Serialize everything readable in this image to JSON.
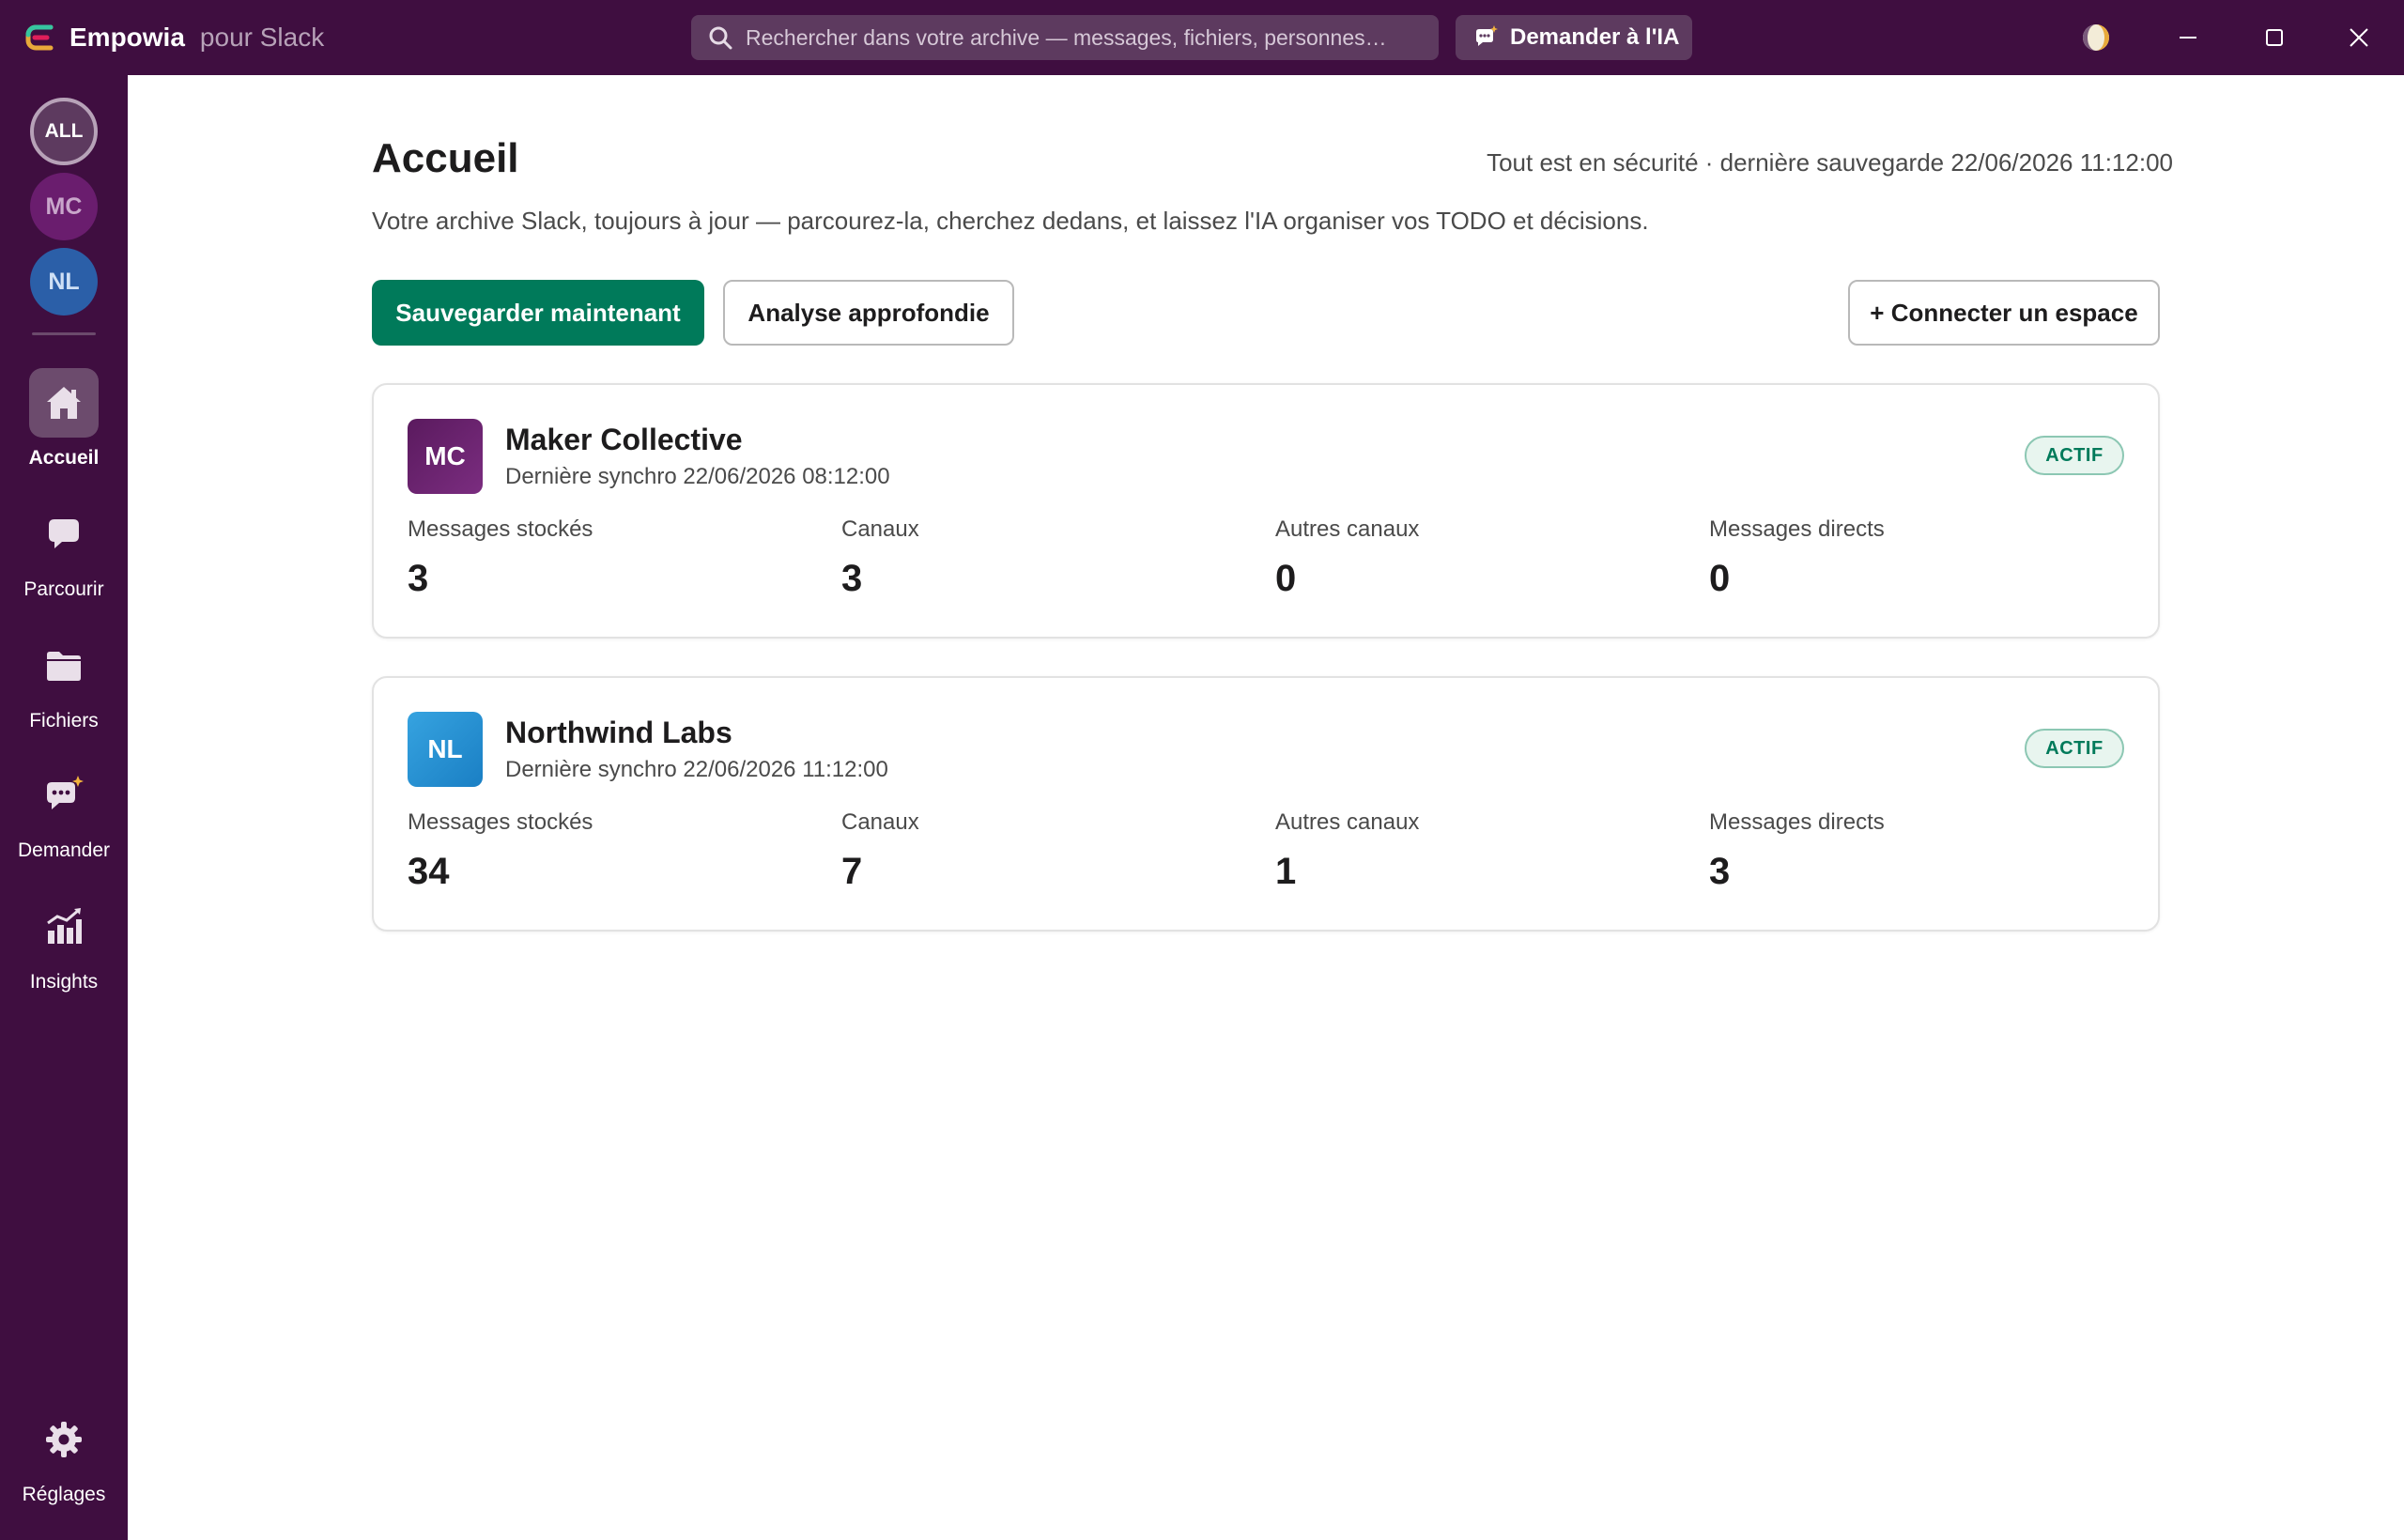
{
  "app": {
    "name": "Empowia",
    "subtitle": "pour Slack"
  },
  "titlebar": {
    "search_placeholder": "Rechercher dans votre archive — messages, fichiers, personnes…",
    "ask_ai_label": "Demander à l'IA"
  },
  "sidebar": {
    "workspaces": [
      "ALL",
      "MC",
      "NL"
    ],
    "nav": [
      {
        "label": "Accueil",
        "icon": "home-icon",
        "active": true
      },
      {
        "label": "Parcourir",
        "icon": "chat-bubble-icon"
      },
      {
        "label": "Fichiers",
        "icon": "folder-icon"
      },
      {
        "label": "Demander",
        "icon": "ai-chat-icon"
      },
      {
        "label": "Insights",
        "icon": "chart-icon"
      }
    ],
    "settings_label": "Réglages"
  },
  "main": {
    "title": "Accueil",
    "status": "Tout est en sécurité · dernière sauvegarde 22/06/2026 11:12:00",
    "subtitle": "Votre archive Slack, toujours à jour — parcourez-la, cherchez dedans, et laissez l'IA organiser vos TODO et décisions.",
    "buttons": {
      "backup": "Sauvegarder maintenant",
      "analysis": "Analyse approfondie",
      "connect": "+ Connecter un espace"
    }
  },
  "workspaces": [
    {
      "initials": "MC",
      "name": "Maker Collective",
      "last_sync": "Dernière synchro 22/06/2026 08:12:00",
      "status": "ACTIF",
      "stats": [
        {
          "label": "Messages stockés",
          "value": "3"
        },
        {
          "label": "Canaux",
          "value": "3"
        },
        {
          "label": "Autres canaux",
          "value": "0"
        },
        {
          "label": "Messages directs",
          "value": "0"
        }
      ]
    },
    {
      "initials": "NL",
      "name": "Northwind Labs",
      "last_sync": "Dernière synchro 22/06/2026 11:12:00",
      "status": "ACTIF",
      "stats": [
        {
          "label": "Messages stockés",
          "value": "34"
        },
        {
          "label": "Canaux",
          "value": "7"
        },
        {
          "label": "Autres canaux",
          "value": "1"
        },
        {
          "label": "Messages directs",
          "value": "3"
        }
      ]
    }
  ],
  "colors": {
    "aubergine": "#3f0e40",
    "primary_green": "#007a5a",
    "badge_bg": "#e8f5ef"
  }
}
